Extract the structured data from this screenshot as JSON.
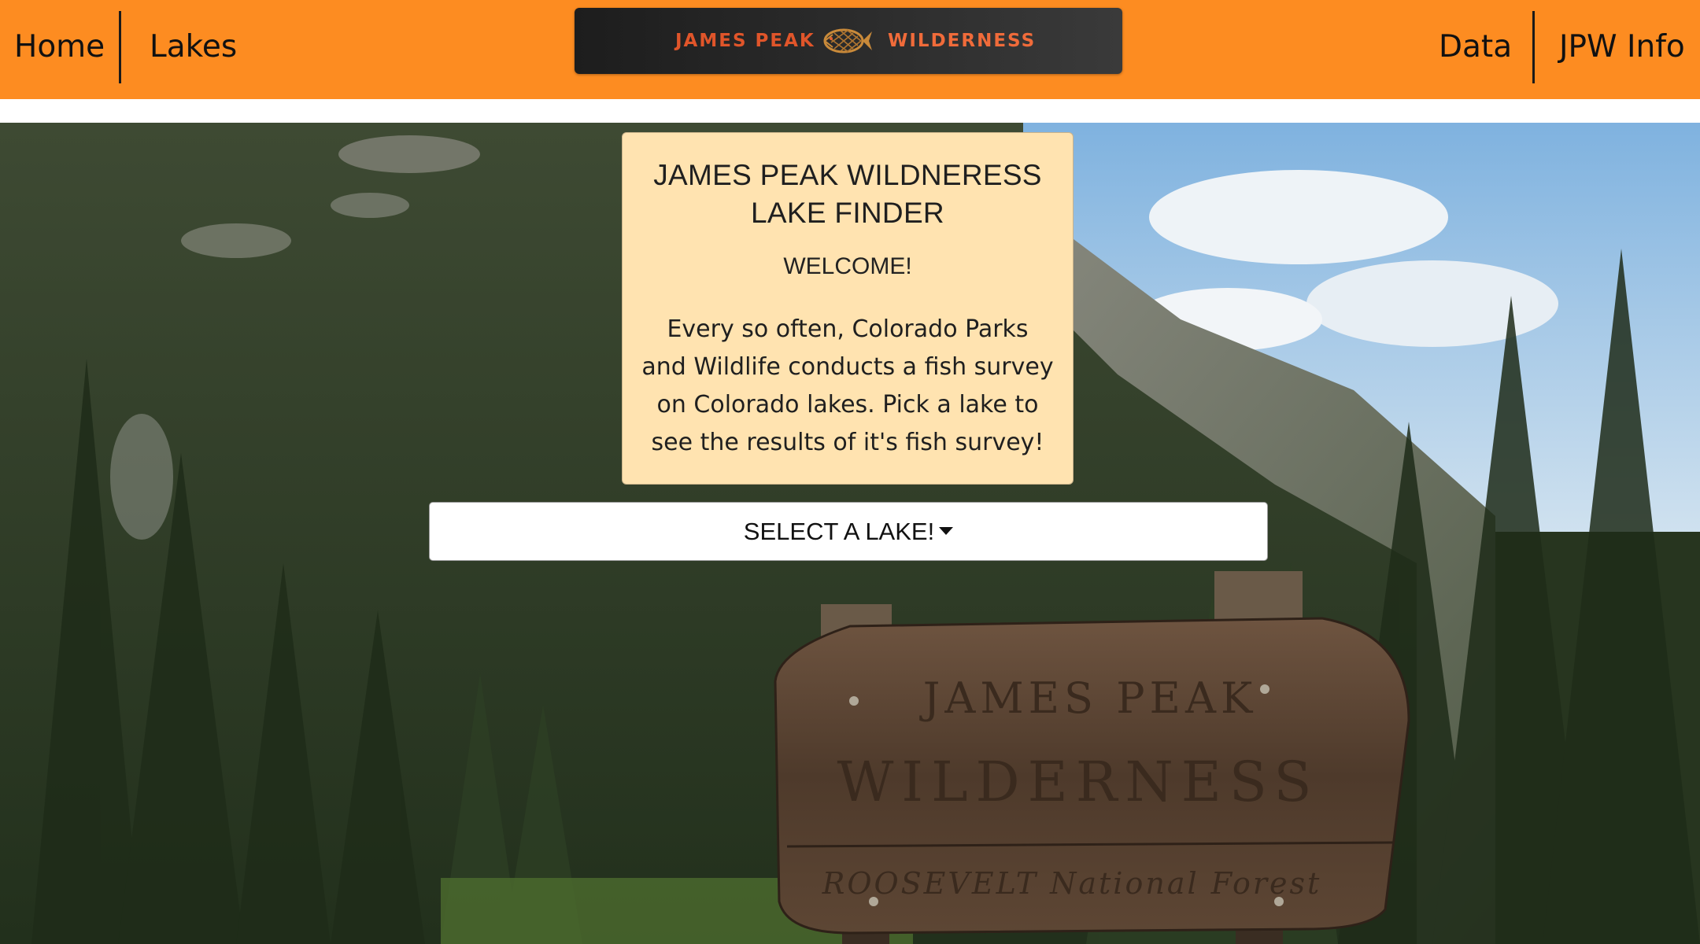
{
  "navbar": {
    "left_links": [
      {
        "label": "Home"
      },
      {
        "label": "Lakes"
      }
    ],
    "right_links": [
      {
        "label": "Data"
      },
      {
        "label": "JPW Info"
      }
    ],
    "brand": {
      "left_text": "JAMES PEAK",
      "right_text": "WILDERNESS",
      "icon": "fish-icon"
    },
    "background_color": "#fd8c21"
  },
  "hero": {
    "sign": {
      "line1": "JAMES PEAK",
      "line2": "WILDERNESS",
      "line3": "ROOSEVELT National Forest"
    }
  },
  "welcome_card": {
    "title": "JAMES PEAK WILDNERESS LAKE FINDER",
    "welcome": "WELCOME!",
    "body": "Every so often, Colorado Parks and Wildlife conducts a fish survey on Colorado lakes. Pick a lake to see the results of it's fish survey!",
    "background_color": "#ffe3b0"
  },
  "lake_select": {
    "label": "SELECT A LAKE!",
    "icon": "caret-down-icon"
  }
}
